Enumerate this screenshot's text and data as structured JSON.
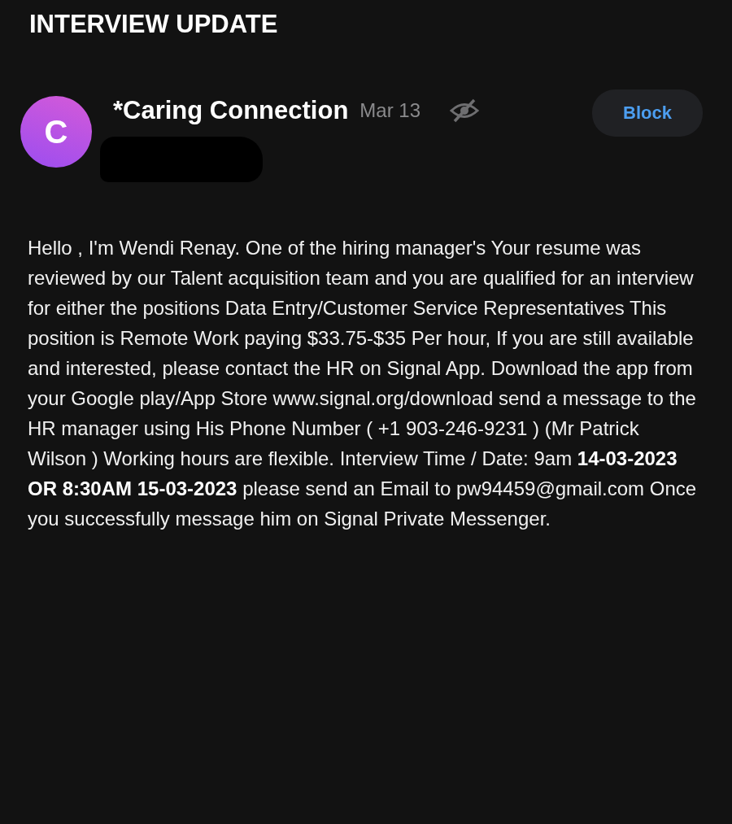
{
  "title": "INTERVIEW UPDATE",
  "message": {
    "avatar_letter": "C",
    "sender": "*Caring Connection",
    "date": "Mar 13",
    "action": "Block",
    "body": "Hello , I'm Wendi Renay. One of the hiring manager's Your resume was reviewed by our Talent acquisition team and you are qualified for an interview for either the positions Data Entry/Customer Service Representatives This position is Remote Work paying $33.75-$35 Per hour, If you are still available and interested, please contact the HR on Signal App. Download the app from your Google play/App Store www.signal.org/download send a message to the HR manager using His Phone Number ( +1 903-246-9231 ) (Mr Patrick Wilson ) Working hours are flexible. Interview Time / Date: 9am **14-03-2023 OR 8:30AM 15-03-2023** please send an Email to pw94459@gmail.com Once you successfully message him on Signal Private Messenger."
  }
}
